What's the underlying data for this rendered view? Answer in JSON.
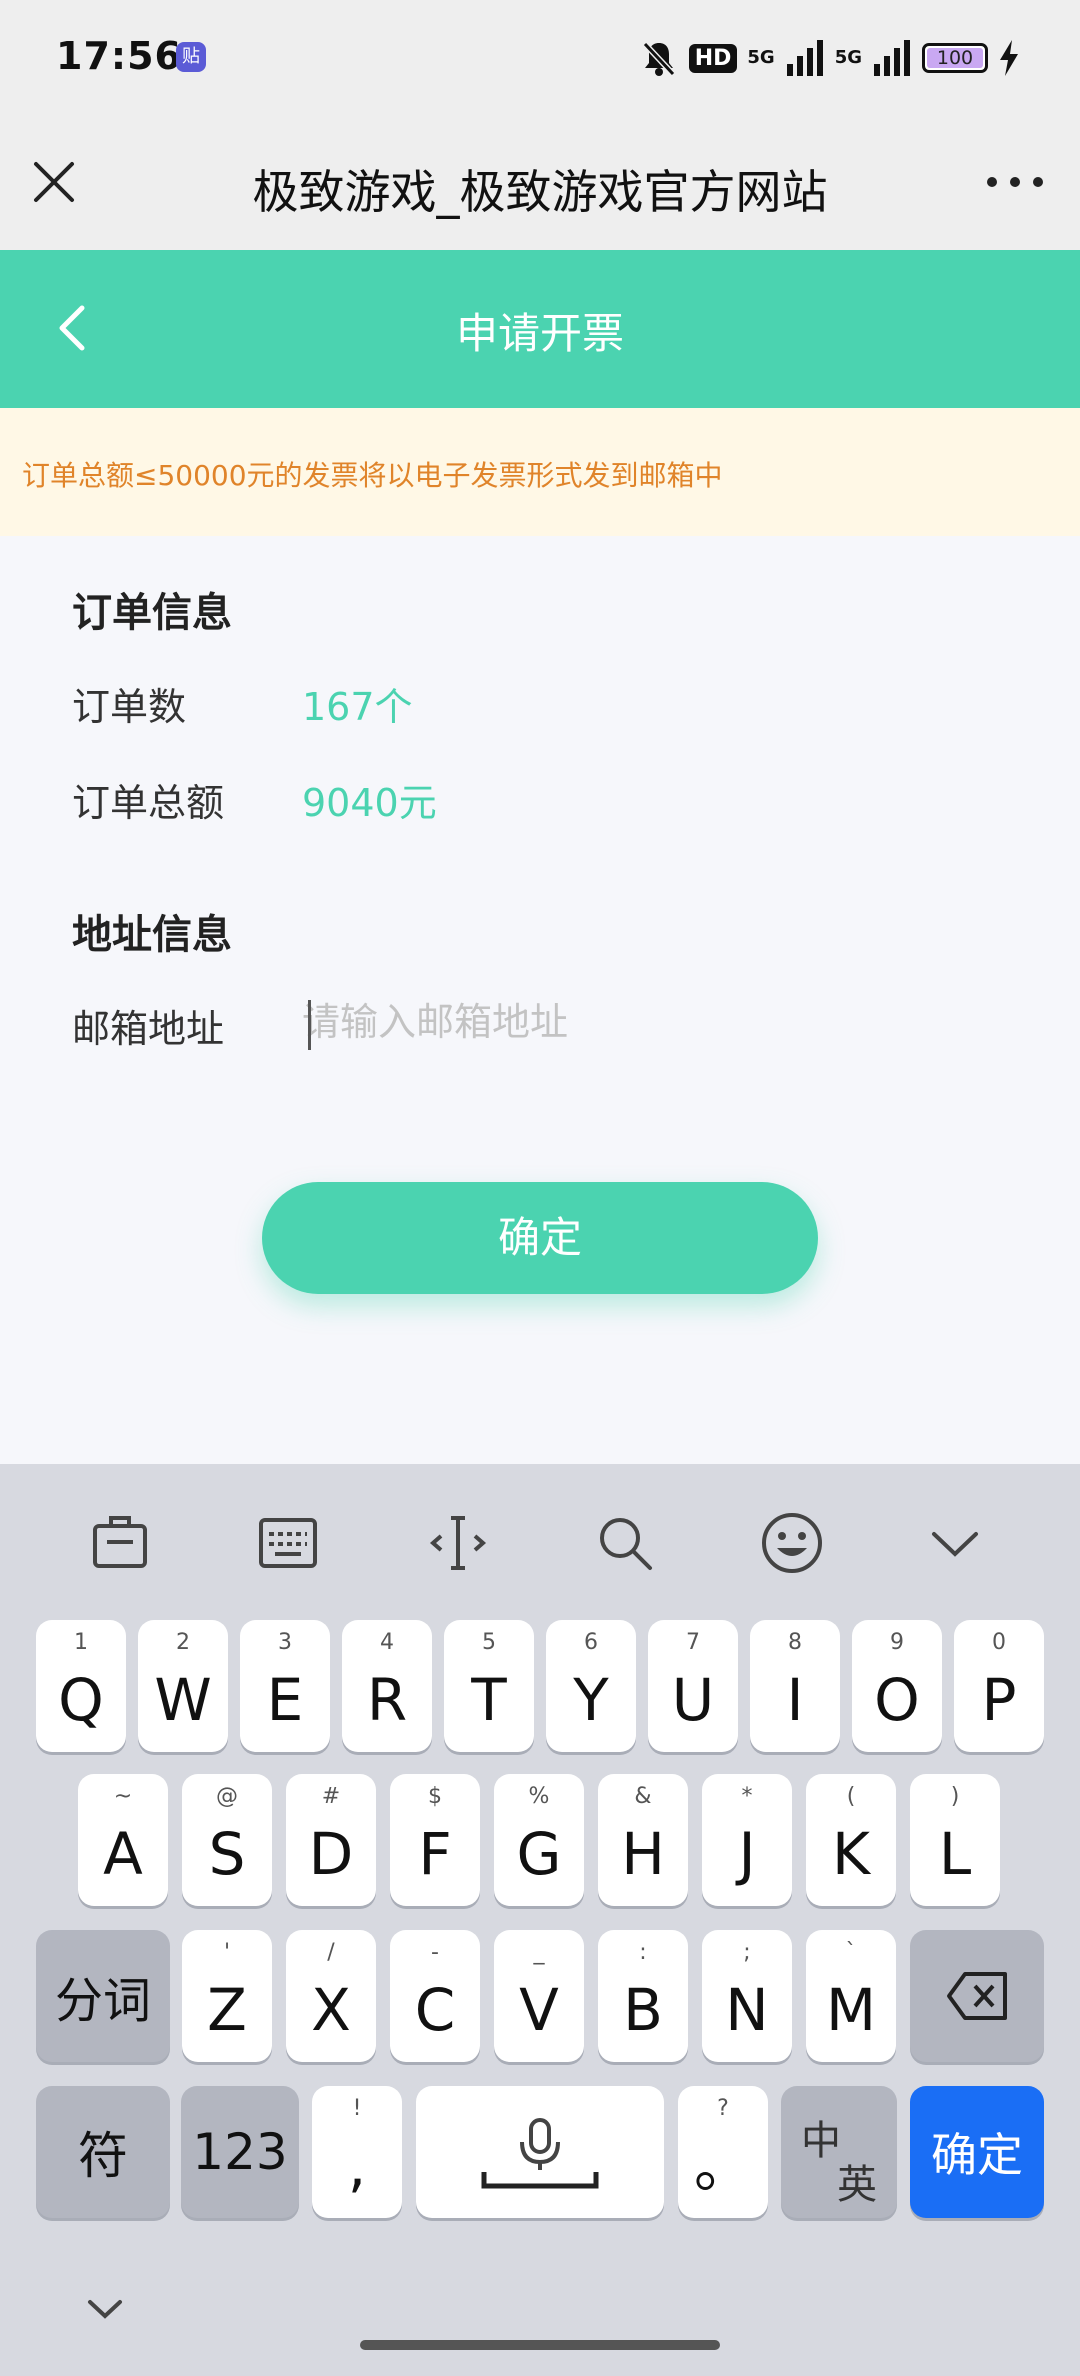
{
  "status_bar": {
    "time": "17:56",
    "app_icon_glyph": "贴",
    "hd": "HD",
    "network_1": "5G",
    "network_2": "5G",
    "battery": "100"
  },
  "browser": {
    "title": "极致游戏_极致游戏官方网站"
  },
  "header": {
    "title": "申请开票"
  },
  "notice": {
    "text": "订单总额≤50000元的发票将以电子发票形式发到邮箱中"
  },
  "order_info": {
    "section_title": "订单信息",
    "count_label": "订单数",
    "count_value": "167个",
    "total_label": "订单总额",
    "total_value": "9040元"
  },
  "address_info": {
    "section_title": "地址信息",
    "email_label": "邮箱地址",
    "email_placeholder": "请输入邮箱地址",
    "email_value": ""
  },
  "confirm_button": "确定",
  "keyboard": {
    "toolbar_icons": [
      "clipboard-icon",
      "keyboard-icon",
      "cursor-icon",
      "search-icon",
      "emoji-icon",
      "chevron-down-icon"
    ],
    "row1": [
      {
        "key": "Q",
        "sub": "1"
      },
      {
        "key": "W",
        "sub": "2"
      },
      {
        "key": "E",
        "sub": "3"
      },
      {
        "key": "R",
        "sub": "4"
      },
      {
        "key": "T",
        "sub": "5"
      },
      {
        "key": "Y",
        "sub": "6"
      },
      {
        "key": "U",
        "sub": "7"
      },
      {
        "key": "I",
        "sub": "8"
      },
      {
        "key": "O",
        "sub": "9"
      },
      {
        "key": "P",
        "sub": "0"
      }
    ],
    "row2": [
      {
        "key": "A",
        "sub": "~"
      },
      {
        "key": "S",
        "sub": "@"
      },
      {
        "key": "D",
        "sub": "#"
      },
      {
        "key": "F",
        "sub": "$"
      },
      {
        "key": "G",
        "sub": "%"
      },
      {
        "key": "H",
        "sub": "&"
      },
      {
        "key": "J",
        "sub": "*"
      },
      {
        "key": "K",
        "sub": "("
      },
      {
        "key": "L",
        "sub": ")"
      }
    ],
    "row3": [
      {
        "key": "Z",
        "sub": "'"
      },
      {
        "key": "X",
        "sub": "/"
      },
      {
        "key": "C",
        "sub": "-"
      },
      {
        "key": "V",
        "sub": "_"
      },
      {
        "key": "B",
        "sub": ":"
      },
      {
        "key": "N",
        "sub": ";"
      },
      {
        "key": "M",
        "sub": "`"
      }
    ],
    "segment_key": "分词",
    "symbol_key": "符",
    "number_key": "123",
    "comma_key": ",",
    "comma_sub": "!",
    "period_key": "。",
    "period_sub": "?",
    "lang_key_top": "中",
    "lang_key_bottom": "英",
    "enter_key": "确定"
  },
  "colors": {
    "accent": "#4bd3b0",
    "notice_text": "#e0842a",
    "notice_bg": "#fff8e6",
    "keyboard_enter": "#1a6ef5"
  }
}
